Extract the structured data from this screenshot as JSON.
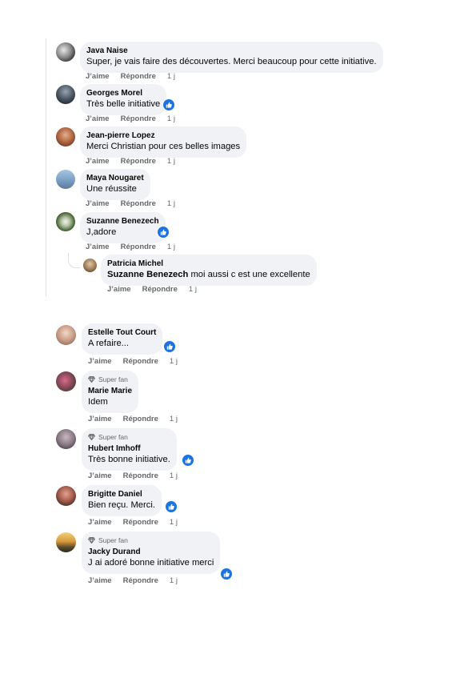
{
  "actions": {
    "like": "J’aime",
    "reply": "Répondre",
    "time": "1 j"
  },
  "colors": {
    "bubble": "#f0f2f5",
    "like_badge": "#1b74e4",
    "meta_text": "#65676b"
  },
  "super_fan_label": "Super fan",
  "thread1": [
    {
      "name": "Java Naise",
      "text": "Super, je vais faire des découvertes. Merci beaucoup pour cette initiative.",
      "reaction": false
    },
    {
      "name": "Georges Morel",
      "text": "Très belle initiative",
      "reaction": true
    },
    {
      "name": "Jean-pierre Lopez",
      "text": "Merci Christian pour ces belles images",
      "reaction": false
    },
    {
      "name": "Maya Nougaret",
      "text": "Une réussite",
      "reaction": false
    },
    {
      "name": "Suzanne Benezech",
      "text": "J,adore",
      "reaction": true
    }
  ],
  "reply": {
    "name": "Patricia Michel",
    "mention": "Suzanne Benezech",
    "text": " moi aussi c est une excellente"
  },
  "thread2": [
    {
      "name": "Estelle Tout Court",
      "text": "A refaire...",
      "reaction": true,
      "super_fan": false
    },
    {
      "name": "Marie Marie",
      "text": "Idem",
      "reaction": false,
      "super_fan": true
    },
    {
      "name": "Hubert Imhoff",
      "text": "Très bonne initiative.",
      "reaction": true,
      "super_fan": true
    },
    {
      "name": "Brigitte Daniel",
      "text": "Bien reçu. Merci.",
      "reaction": true,
      "super_fan": false
    },
    {
      "name": "Jacky Durand",
      "text": "J ai adoré bonne initiative merci",
      "reaction": true,
      "super_fan": true
    }
  ]
}
